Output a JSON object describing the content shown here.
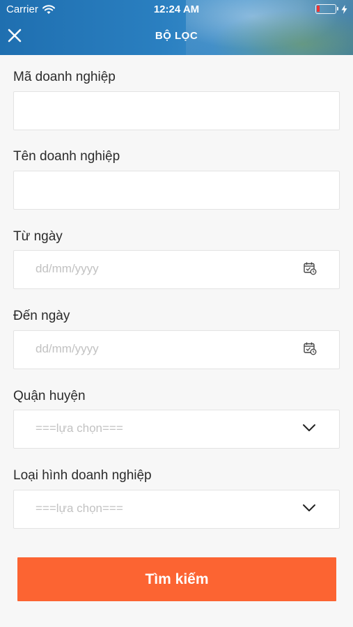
{
  "status_bar": {
    "carrier": "Carrier",
    "time": "12:24 AM",
    "battery_color": "#e33333"
  },
  "nav": {
    "title": "BỘ LỌC",
    "close_icon": "close-icon"
  },
  "fields": {
    "ma_doanh_nghiep": {
      "label": "Mã doanh nghiệp",
      "value": ""
    },
    "ten_doanh_nghiep": {
      "label": "Tên doanh nghiệp",
      "value": ""
    },
    "tu_ngay": {
      "label": "Từ ngày",
      "placeholder": "dd/mm/yyyy",
      "icon": "calendar-icon"
    },
    "den_ngay": {
      "label": "Đến ngày",
      "placeholder": "dd/mm/yyyy",
      "icon": "calendar-icon"
    },
    "quan_huyen": {
      "label": "Quận huyện",
      "selected": "===lựa chọn===",
      "icon": "chevron-down-icon"
    },
    "loai_hinh": {
      "label": "Loại hình doanh nghiệp",
      "selected": "===lựa chọn===",
      "icon": "chevron-down-icon"
    }
  },
  "search_button": {
    "label": "Tìm kiếm",
    "color": "#fc6432"
  },
  "colors": {
    "header": "#2a7fc0",
    "background": "#f7f7f7",
    "accent": "#fc6432"
  }
}
